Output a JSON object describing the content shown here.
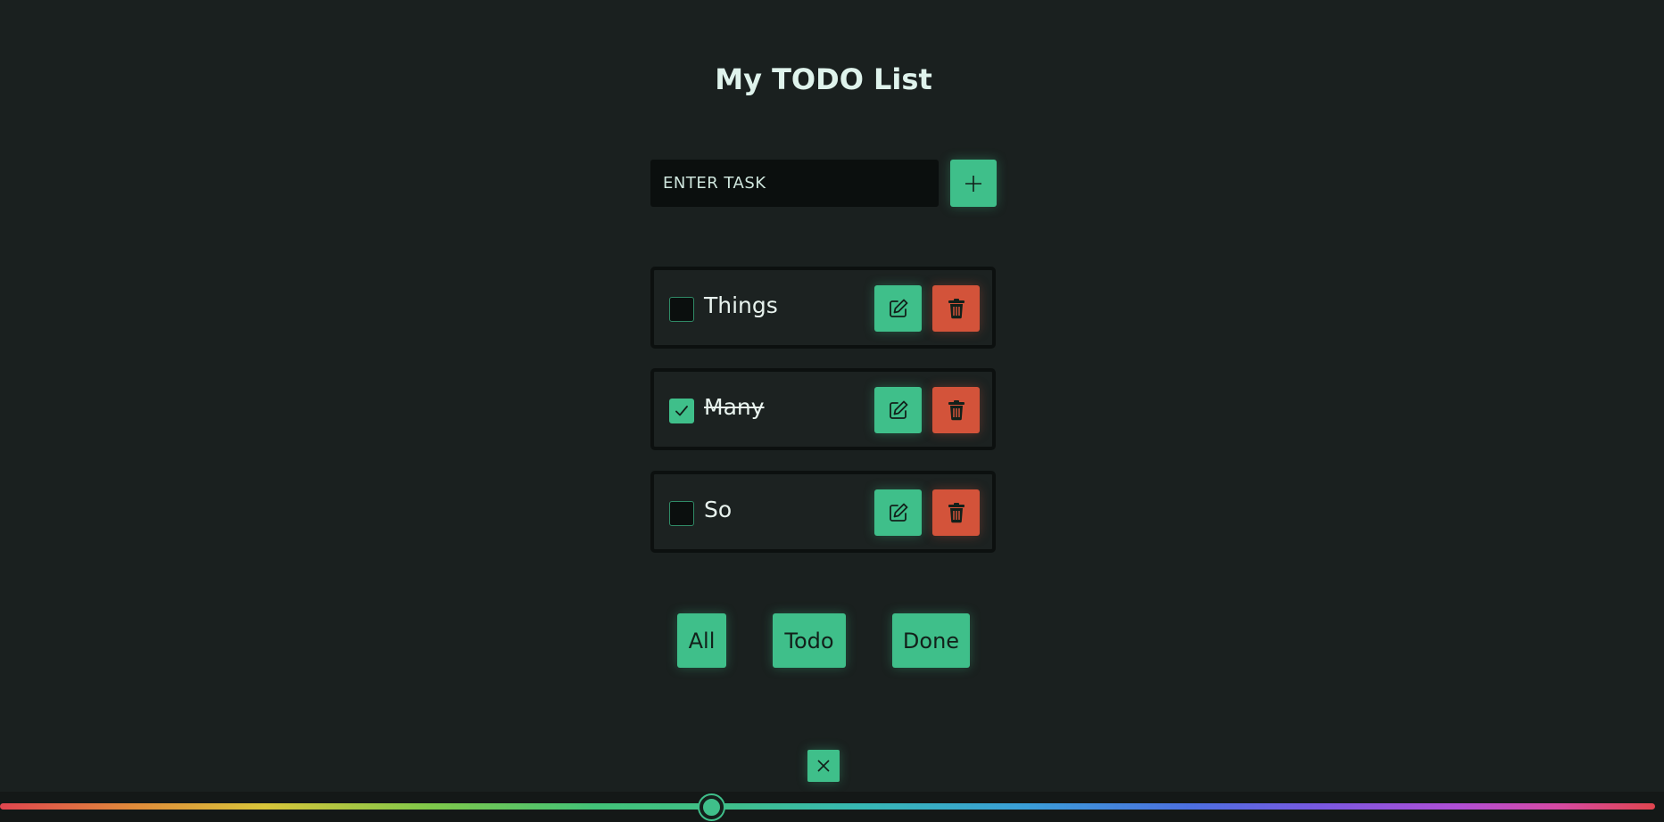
{
  "header": {
    "title": "My TODO List"
  },
  "add_form": {
    "input_placeholder": "ENTER TASK",
    "input_value": "",
    "add_icon": "plus-icon"
  },
  "todos": [
    {
      "label": "Things",
      "done": false
    },
    {
      "label": "Many",
      "done": true
    },
    {
      "label": "So",
      "done": false
    }
  ],
  "item_actions": {
    "edit_icon": "pencil-square-icon",
    "delete_icon": "trash-icon"
  },
  "filters": [
    {
      "label": "All"
    },
    {
      "label": "Todo"
    },
    {
      "label": "Done"
    }
  ],
  "close_icon": "x-icon",
  "hue_slider": {
    "value_fraction": 0.43
  },
  "colors": {
    "background": "#1a201f",
    "accent": "#3fbf8a",
    "danger": "#d3533a",
    "input_background": "#0b0f0e",
    "item_border": "#0c100f"
  }
}
